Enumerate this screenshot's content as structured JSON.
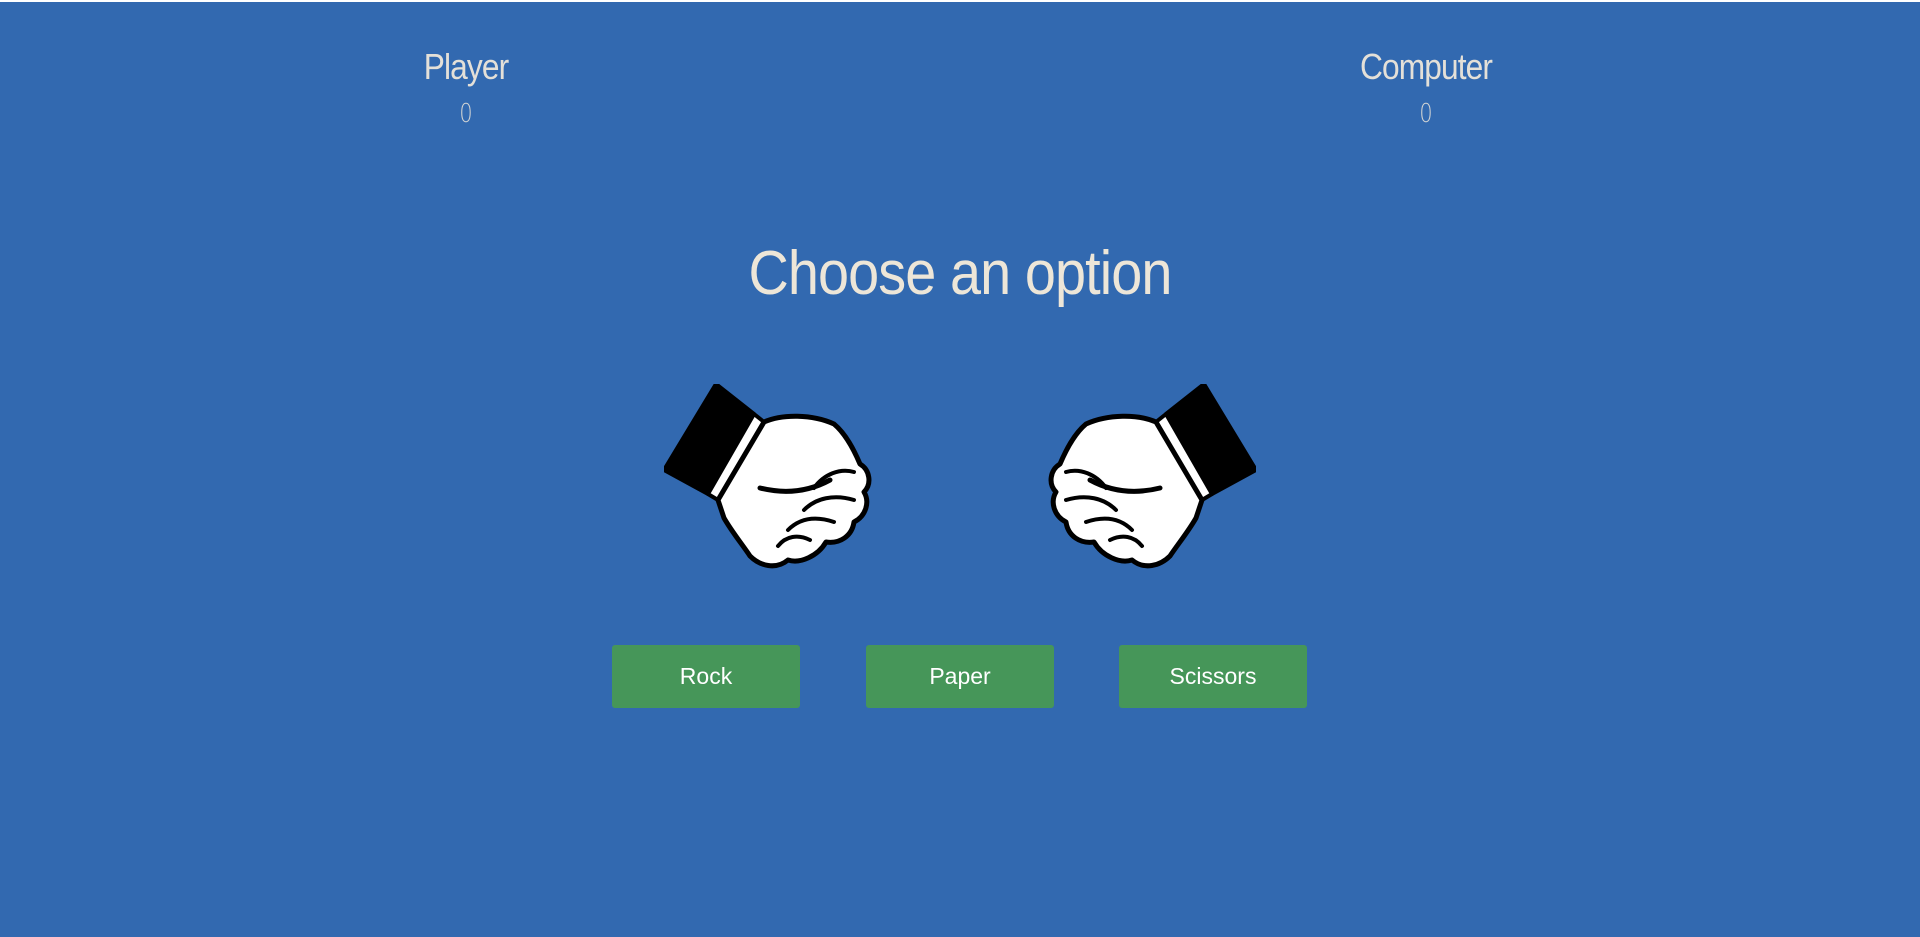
{
  "scoreboard": {
    "player": {
      "label": "Player",
      "score": "0"
    },
    "computer": {
      "label": "Computer",
      "score": "0"
    }
  },
  "prompt": "Choose an option",
  "hands": {
    "player": {
      "icon": "rock-fist-icon",
      "facing": "right"
    },
    "computer": {
      "icon": "rock-fist-icon",
      "facing": "left"
    }
  },
  "buttons": {
    "rock": "Rock",
    "paper": "Paper",
    "scissors": "Scissors"
  },
  "colors": {
    "background": "#3269b0",
    "button": "#469659",
    "text": "#ede6d8"
  }
}
